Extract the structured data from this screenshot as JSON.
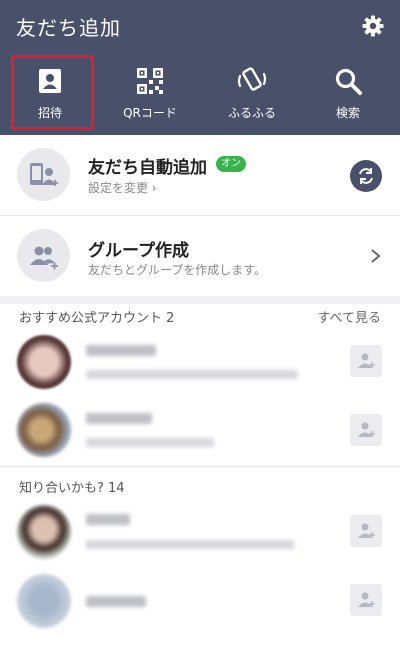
{
  "header": {
    "title": "友だち追加",
    "settings_icon": "gear-icon"
  },
  "tabs": [
    {
      "label": "招待",
      "icon": "invite-card-icon",
      "selected": true
    },
    {
      "label": "QRコード",
      "icon": "qr-code-icon"
    },
    {
      "label": "ふるふる",
      "icon": "shake-phone-icon"
    },
    {
      "label": "検索",
      "icon": "search-icon"
    }
  ],
  "auto_add": {
    "title": "友だち自動追加",
    "badge": "オン",
    "subtitle": "設定を変更 ›",
    "icon": "auto-add-icon",
    "action_icon": "sync-icon"
  },
  "group": {
    "title": "グループ作成",
    "subtitle": "友だちとグループを作成します。",
    "icon": "group-icon",
    "action_icon": "chevron-right-icon"
  },
  "recommended": {
    "heading": "おすすめ公式アカウント 2",
    "see_all": "すべて見る"
  },
  "suggestions": {
    "heading": "知り合いかも? 14"
  },
  "colors": {
    "header_bg": "#49506a",
    "badge_green": "#37b44a",
    "highlight_red": "#e21d2d"
  }
}
